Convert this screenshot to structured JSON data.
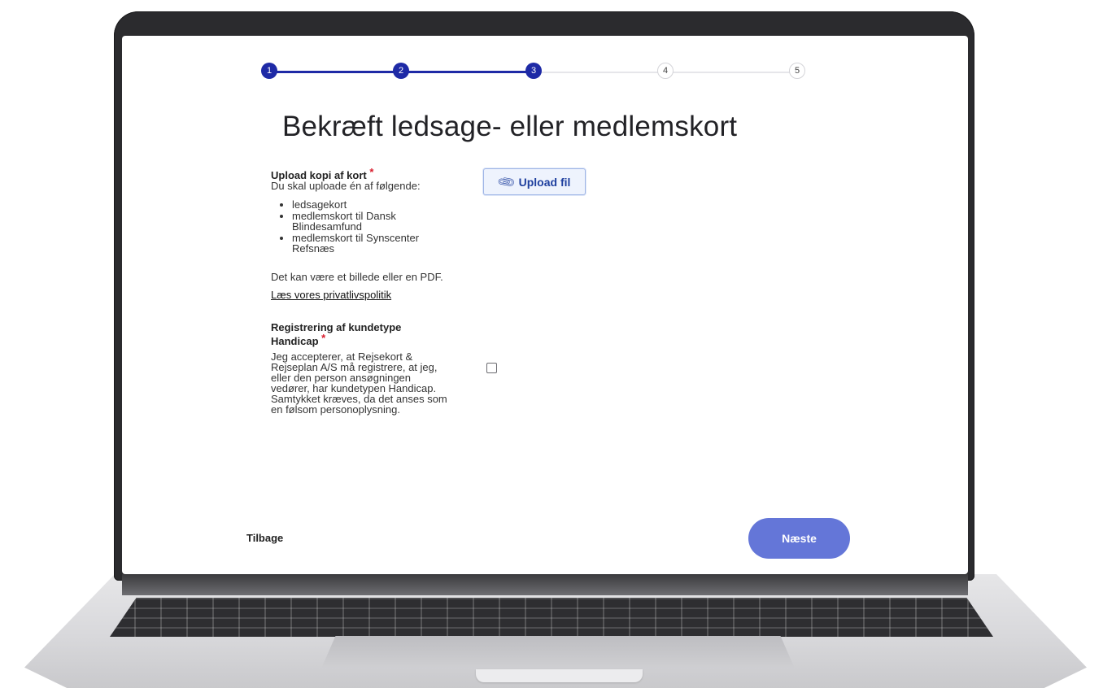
{
  "stepper": {
    "current": 3,
    "steps": [
      {
        "label": "1",
        "state": "done"
      },
      {
        "label": "2",
        "state": "done"
      },
      {
        "label": "3",
        "state": "current"
      },
      {
        "label": "4",
        "state": "todo"
      },
      {
        "label": "5",
        "state": "todo"
      }
    ]
  },
  "page": {
    "title": "Bekræft ledsage- eller medlemskort"
  },
  "upload": {
    "label": "Upload kopi af kort",
    "required_mark": "*",
    "intro": "Du skal uploade én af følgende:",
    "options": [
      "ledsagekort",
      "medlemskort til Dansk Blindesamfund",
      "medlemskort til Synscenter Refsnæs"
    ],
    "format_note": "Det kan være et billede eller en PDF.",
    "privacy_link": "Læs vores privatlivspolitik",
    "button_label": "Upload fil",
    "button_icon": "paperclip-icon"
  },
  "consent": {
    "label": "Registrering af kundetype Handicap",
    "required_mark": "*",
    "text": "Jeg accepterer, at Rejsekort & Rejseplan A/S må registrere, at jeg, eller den person ansøgningen vedører, har kundetypen Handicap. Samtykket kræves, da det anses som en følsom personoplysning.",
    "checked": false
  },
  "footer": {
    "back_label": "Tilbage",
    "next_label": "Næste"
  },
  "colors": {
    "step_active": "#1e2aa6",
    "next_button": "#6476d8",
    "required": "#d81b2b",
    "upload_button_text": "#1e3f9e"
  }
}
